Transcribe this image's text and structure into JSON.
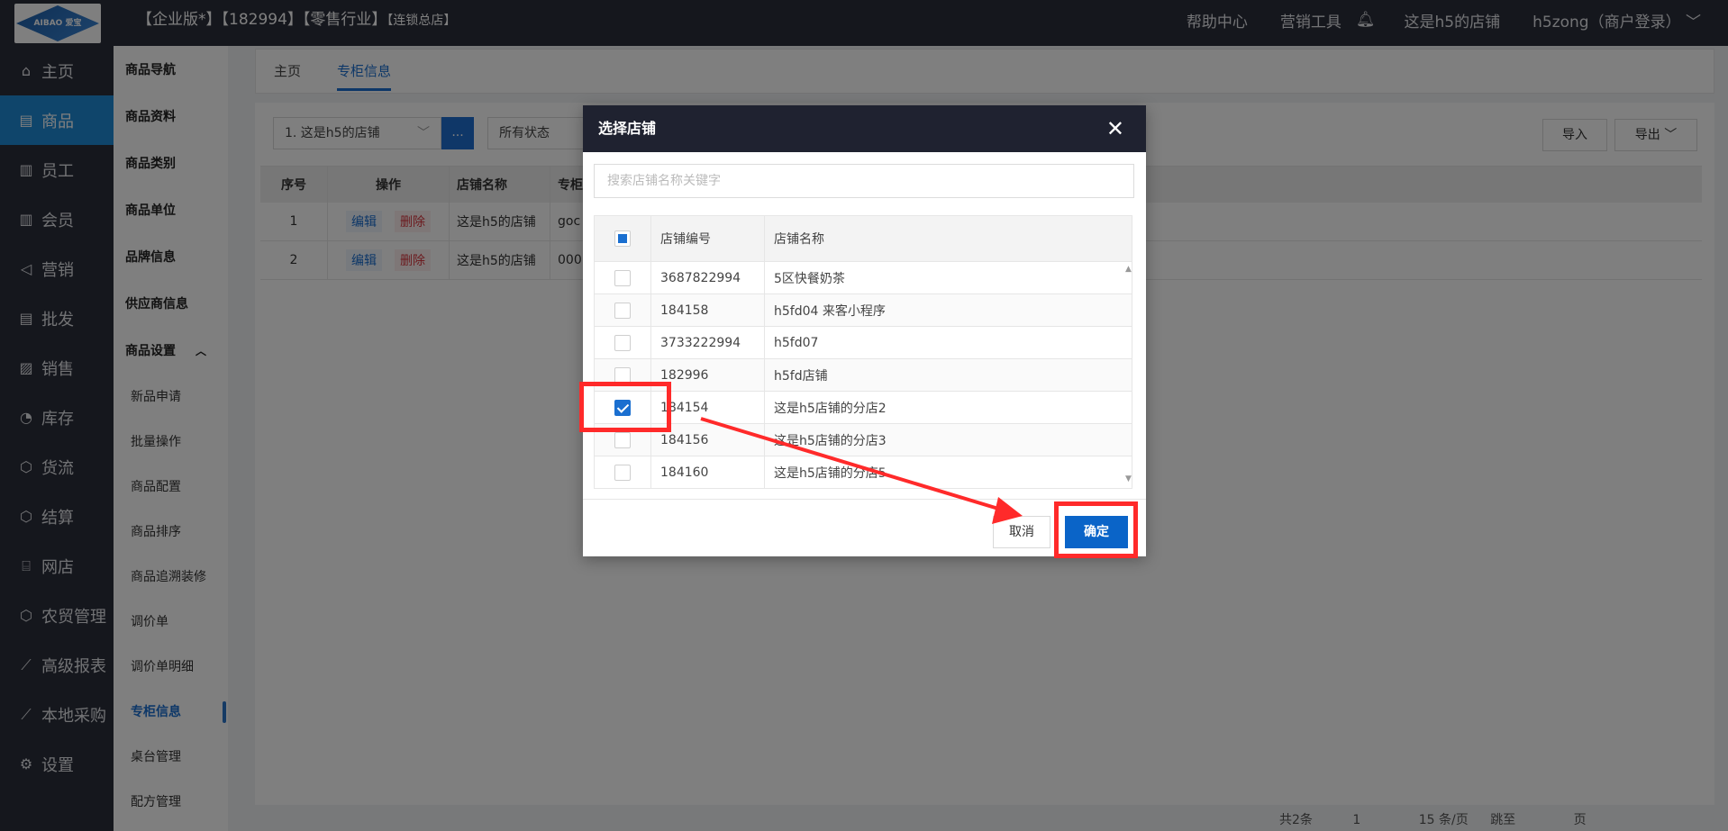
{
  "topbar": {
    "logo_text": "AIBAO 爱宝",
    "title_main": "【企业版*】【182994】【零售行业】",
    "title_small": "【连锁总店】",
    "links": [
      "帮助中心",
      "营销工具",
      "这是h5的店铺",
      "h5zong（商户登录）"
    ]
  },
  "nav": {
    "items": [
      {
        "icon": "home-icon",
        "glyph": "⌂",
        "label": "主页"
      },
      {
        "icon": "goods-icon",
        "glyph": "▤",
        "label": "商品"
      },
      {
        "icon": "staff-icon",
        "glyph": "▥",
        "label": "员工"
      },
      {
        "icon": "member-icon",
        "glyph": "▥",
        "label": "会员"
      },
      {
        "icon": "marketing-icon",
        "glyph": "◁",
        "label": "营销"
      },
      {
        "icon": "wholesale-icon",
        "glyph": "▤",
        "label": "批发"
      },
      {
        "icon": "sales-icon",
        "glyph": "▨",
        "label": "销售"
      },
      {
        "icon": "inventory-icon",
        "glyph": "◔",
        "label": "库存"
      },
      {
        "icon": "logistics-icon",
        "glyph": "⬡",
        "label": "货流"
      },
      {
        "icon": "settlement-icon",
        "glyph": "⬡",
        "label": "结算"
      },
      {
        "icon": "webstore-icon",
        "glyph": "⌸",
        "label": "网店"
      },
      {
        "icon": "farm-trade-icon",
        "glyph": "⬡",
        "label": "农贸管理"
      },
      {
        "icon": "report-icon",
        "glyph": "⟋",
        "label": "高级报表"
      },
      {
        "icon": "purchase-icon",
        "glyph": "⟋",
        "label": "本地采购"
      },
      {
        "icon": "settings-icon",
        "glyph": "⚙",
        "label": "设置"
      }
    ]
  },
  "subnav": {
    "items": [
      "商品导航",
      "商品资料",
      "商品类别",
      "商品单位",
      "品牌信息",
      "供应商信息"
    ],
    "group": "商品设置",
    "children": [
      "新品申请",
      "批量操作",
      "商品配置",
      "商品排序",
      "商品追溯装修",
      "调价单",
      "调价单明细",
      "专柜信息",
      "桌台管理",
      "配方管理"
    ]
  },
  "tabs": [
    "主页",
    "专柜信息"
  ],
  "filters": {
    "store": "1. 这是h5的店铺",
    "dots": "...",
    "status": "所有状态",
    "import": "导入",
    "export": "导出"
  },
  "table": {
    "headers": [
      "序号",
      "操作",
      "店铺名称",
      "专柜"
    ],
    "edit": "编辑",
    "delete": "删除",
    "rows": [
      {
        "no": "1",
        "store": "这是h5的店铺",
        "counter": "goc"
      },
      {
        "no": "2",
        "store": "这是h5的店铺",
        "counter": "000"
      }
    ]
  },
  "pager": {
    "total": "共2条",
    "page": "1",
    "size": "15 条/页",
    "goto": "跳至",
    "page_unit": "页"
  },
  "dialog": {
    "title": "选择店铺",
    "search_placeholder": "搜索店铺名称关键字",
    "headers": [
      "店铺编号",
      "店铺名称"
    ],
    "rows": [
      {
        "id": "3687822994",
        "name": "5区快餐奶茶",
        "checked": false
      },
      {
        "id": "184158",
        "name": "h5fd04 来客小程序",
        "checked": false
      },
      {
        "id": "3733222994",
        "name": "h5fd07",
        "checked": false
      },
      {
        "id": "182996",
        "name": "h5fd店铺",
        "checked": false
      },
      {
        "id": "184154",
        "name": "这是h5店铺的分店2",
        "checked": true
      },
      {
        "id": "184156",
        "name": "这是h5店铺的分店3",
        "checked": false
      },
      {
        "id": "184160",
        "name": "这是h5店铺的分店5",
        "checked": false
      }
    ],
    "cancel": "取消",
    "ok": "确定"
  },
  "colors": {
    "dark": "#2b2e3b",
    "accent": "#1a6fd0",
    "annotation": "#ff2a2a"
  }
}
